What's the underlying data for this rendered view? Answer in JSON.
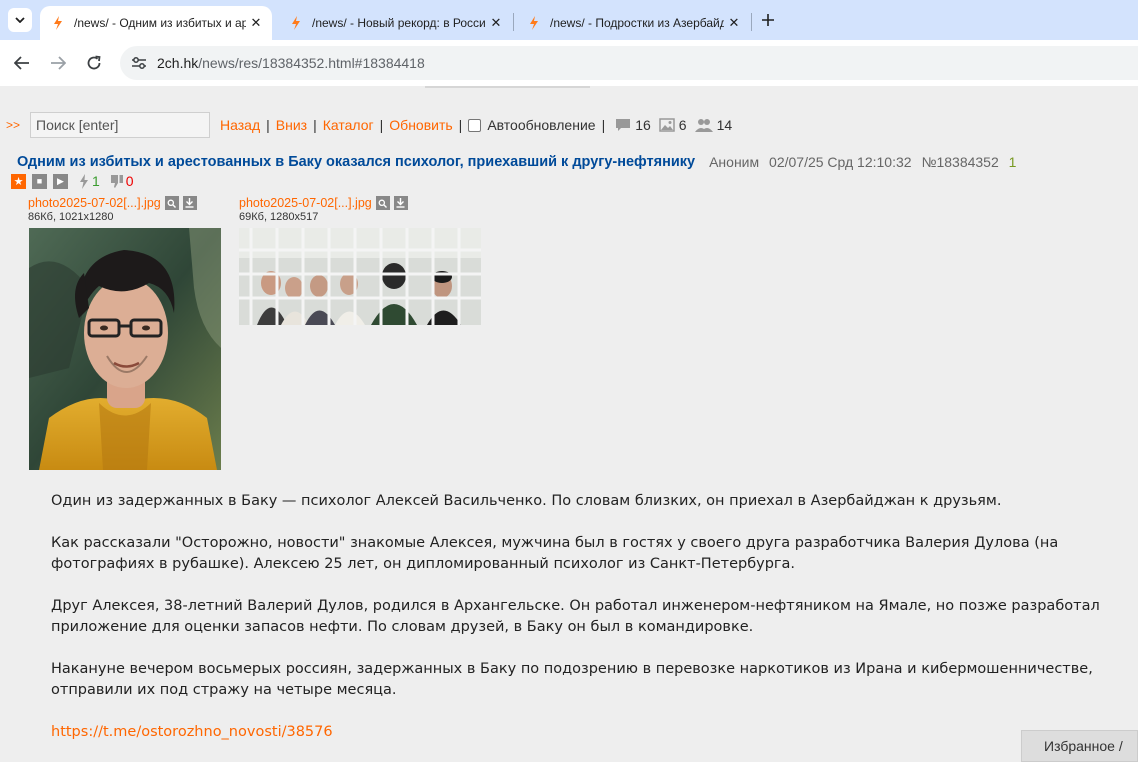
{
  "browser": {
    "tabs": [
      {
        "title": "/news/ - Одним из избитых и арестованных в Баку",
        "active": true
      },
      {
        "title": "/news/ - Новый рекорд: в России",
        "active": false
      },
      {
        "title": "/news/ - Подростки из Азербайджана",
        "active": false
      }
    ],
    "url_host": "2ch.hk",
    "url_path": "/news/res/18384352.html#18384418",
    "colors": {
      "tabbar": "#d3e3fd",
      "accent": "#ff6600"
    }
  },
  "nav": {
    "arrows": ">>",
    "search_placeholder": "Поиск [enter]",
    "back": "Назад",
    "down": "Вниз",
    "catalog": "Каталог",
    "refresh": "Обновить",
    "autoupdate": "Автообновление",
    "posts_count": "16",
    "images_count": "6",
    "posters_count": "14"
  },
  "post": {
    "title": "Одним из избитых и арестованных в Баку оказался психолог, приехавший к другу-нефтянику",
    "author": "Аноним",
    "date": "02/07/25 Срд 12:10:32",
    "number": "№18384352",
    "replies": "1",
    "likes": "1",
    "dislikes": "0",
    "files": [
      {
        "name": "photo2025-07-02[...].jpg",
        "meta": "86Кб, 1021x1280"
      },
      {
        "name": "photo2025-07-02[...].jpg",
        "meta": "69Кб, 1280x517"
      }
    ],
    "paragraphs": [
      "Один из задержанных в Баку — психолог Алексей Васильченко. По словам близких, он приехал в Азербайджан к друзьям.",
      "Как рассказали \"Осторожно, новости\" знакомые Алексея, мужчина был в гостях у своего друга разработчика Валерия Дулова (на фотографиях в рубашке). Алексею 25 лет, он дипломированный психолог из Санкт-Петербурга.",
      "Друг Алексея, 38-летний Валерий Дулов, родился в Архангельске. Он работал инженером-нефтяником на Ямале, но позже разработал приложение для оценки запасов нефти. По словам друзей, в Баку он был в командировке.",
      "Накануне вечером восьмерых россиян, задержанных в Баку по подозрению в перевозке наркотиков из Ирана и кибермошенничестве, отправили их под стражу на четыре месяца."
    ],
    "link": "https://t.me/ostorozhno_novosti/38576"
  },
  "favorites": "Избранное /"
}
